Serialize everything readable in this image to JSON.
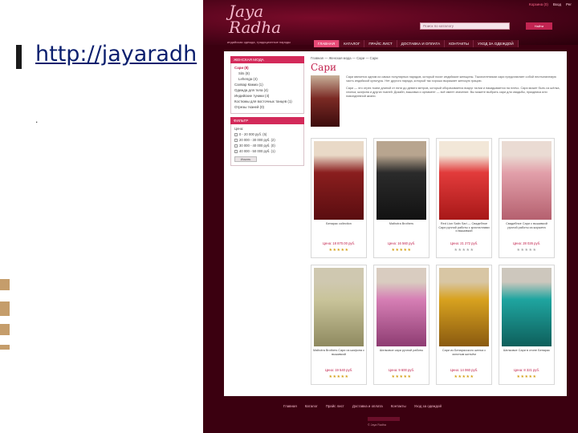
{
  "slide": {
    "link_text": "http://jayaradh",
    "dot": "."
  },
  "site": {
    "logo": [
      "Jaya",
      "Radha"
    ],
    "tagline": "индийская одежда, традиционные наряды",
    "header_links": [
      "Корзина (0)",
      "Вход",
      "Рег"
    ],
    "search_placeholder": "Поиск по каталогу",
    "search_button": "Найти",
    "nav": [
      "ГЛАВНАЯ",
      "КАТАЛОГ",
      "ПРАЙС ЛИСТ",
      "ДОСТАВКА И ОПЛАТА",
      "КОНТАКТЫ",
      "УХОД ЗА ОДЕЖДОЙ"
    ],
    "nav_active_index": 0,
    "sidebar": {
      "heading": "ЖЕНСКАЯ МОДА",
      "items": [
        {
          "label": "Сари (8)",
          "active": true,
          "sub": false
        },
        {
          "label": "Sits (8)",
          "active": false,
          "sub": true
        },
        {
          "label": "Lehenga (4)",
          "active": false,
          "sub": true
        },
        {
          "label": "Салвар Камиз (1)",
          "active": false,
          "sub": false
        },
        {
          "label": "Одежда для тела (4)",
          "active": false,
          "sub": false
        },
        {
          "label": "Индийские туники (4)",
          "active": false,
          "sub": false
        },
        {
          "label": "Костюмы для восточных танцев (1)",
          "active": false,
          "sub": false
        },
        {
          "label": "Отрезы тканей (0)",
          "active": false,
          "sub": false
        }
      ],
      "filter_heading": "ФИЛЬТР",
      "filter_label": "Цена:",
      "filter_options": [
        "0 - 20 000 руб. (5)",
        "20 000 - 30 000 руб. (2)",
        "30 000 - 40 000 руб. (0)",
        "40 000 - 50 000 руб. (1)"
      ],
      "filter_button": "Искать"
    },
    "breadcrumbs": "Главная — Женская мода — Сари — Сари",
    "page_title": "Сари",
    "intro_paragraphs": [
      "Сари является одним из самых популярных нарядов, который носят индийские женщины. Тысячелетиями сари представляет собой неотъемлемую часть индийской культуры. Нет другого наряда, который так хорошо выражает женскую грацию.",
      "Сари — это отрез ткани длиной от пяти до девяти метров, который оборачивается вокруг талии и накидывается на плечо. Сари может быть из шёлка, хлопка, шифона и других тканей. Дизайн, вышивка и орнамент — всё имеет значение. Вы можете выбрать сари для свадьбы, праздника или повседневной жизни."
    ],
    "products_row1": [
      {
        "name": "Бенарас collection",
        "price": "Цена: 18 870.00 руб.",
        "stars": "★★★★★",
        "photo": [
          "#e9d9c7",
          "#8a1e1e",
          "#5a0d10"
        ]
      },
      {
        "name": "Malhotra Brothers",
        "price": "Цена: 16 560 руб.",
        "stars": "★★★★★",
        "photo": [
          "#b8a58f",
          "#2b2b2b",
          "#121212"
        ]
      },
      {
        "name": "Red Lion Satin Sari — Свадебное Сари ручной работы с кристаллами и вышивкой",
        "price": "Цена: 21 272 руб.",
        "stars": "★★★★★",
        "photo": [
          "#f2e7d8",
          "#e23b3b",
          "#a81818"
        ]
      },
      {
        "name": "Свадебное Сари с вышивкой ручной работы из жоржета",
        "price": "Цена: 28 026 руб.",
        "stars": "★★★★★",
        "photo": [
          "#eadbd3",
          "#e2a0aa",
          "#b5606f"
        ]
      }
    ],
    "products_row2": [
      {
        "name": "Malhotra Brothers Сари из шифона с вышивкой",
        "price": "Цена: 19 540 руб.",
        "stars": "★★★★★",
        "photo": [
          "#cfc8b0",
          "#c9c49a",
          "#8f8a60"
        ]
      },
      {
        "name": "Шелковое сари ручной работы",
        "price": "Цена: 9 600 руб.",
        "stars": "★★★★★",
        "photo": [
          "#d9ccc0",
          "#d67fb5",
          "#8e3c72"
        ]
      },
      {
        "name": "Сари из Бенарасского шелка с золотым шитьём",
        "price": "Цена: 14 060 руб.",
        "stars": "★★★★★",
        "photo": [
          "#d8c6a4",
          "#d8a21f",
          "#8a5a10"
        ]
      },
      {
        "name": "Шелковое Сари в стиле Бенарас",
        "price": "Цена: 8 321 руб.",
        "stars": "★★★★★",
        "photo": [
          "#cdc7bd",
          "#1fa5a0",
          "#0e5f5b"
        ]
      }
    ],
    "footer_links": [
      "Главная",
      "Каталог",
      "Прайс лист",
      "Доставка и оплата",
      "Контакты",
      "Уход за одеждой"
    ],
    "footer_copy": "© Jaya Radha"
  }
}
